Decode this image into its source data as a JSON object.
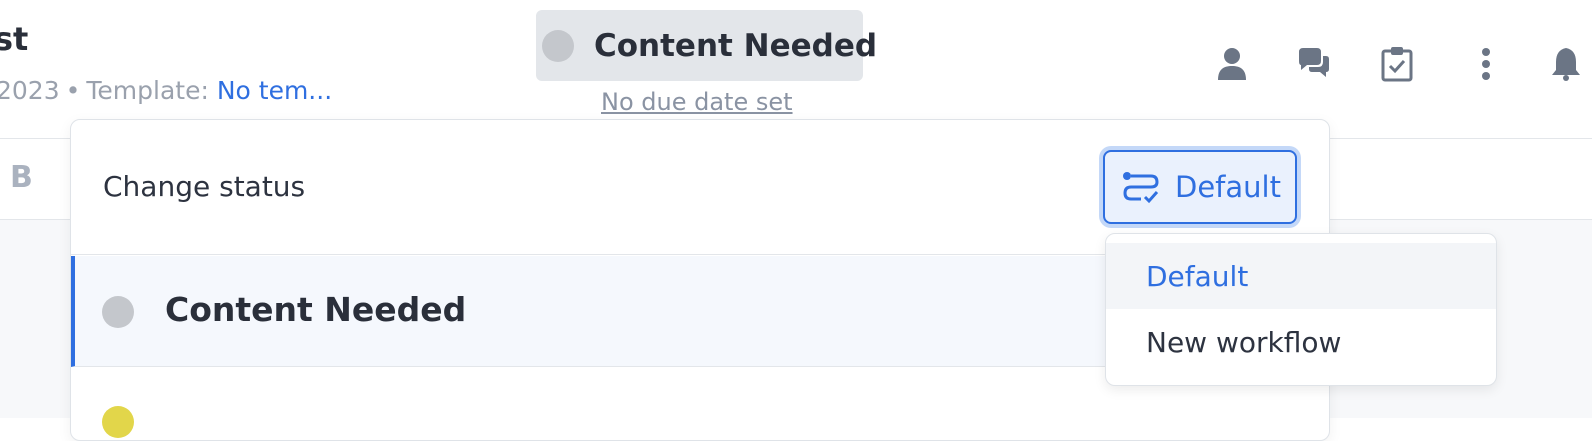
{
  "header": {
    "title_fragment": "st",
    "meta": {
      "date_fragment": "2023",
      "separator": "•",
      "template_label": "Template:",
      "template_value": "No tem..."
    },
    "status": {
      "label": "Content Needed",
      "dot_color": "#c4c7cc"
    },
    "due_date": "No due date set",
    "icons": [
      "user-icon",
      "comments-icon",
      "clipboard-check-icon",
      "more-vertical-icon",
      "bell-icon"
    ]
  },
  "toolbar": {
    "bold_label": "B"
  },
  "status_panel": {
    "title": "Change status",
    "workflow_button_label": "Default",
    "rows": [
      {
        "label": "Content Needed",
        "dot_color": "#c4c7cc",
        "selected": true
      },
      {
        "label": "",
        "dot_color": "#e2d64a",
        "selected": false
      }
    ]
  },
  "workflow_dropdown": {
    "options": [
      "Default",
      "New workflow"
    ],
    "selected": "Default"
  },
  "colors": {
    "accent": "#2f6fe0",
    "muted_text": "#9aa1ad",
    "border": "#e3e6ea"
  }
}
